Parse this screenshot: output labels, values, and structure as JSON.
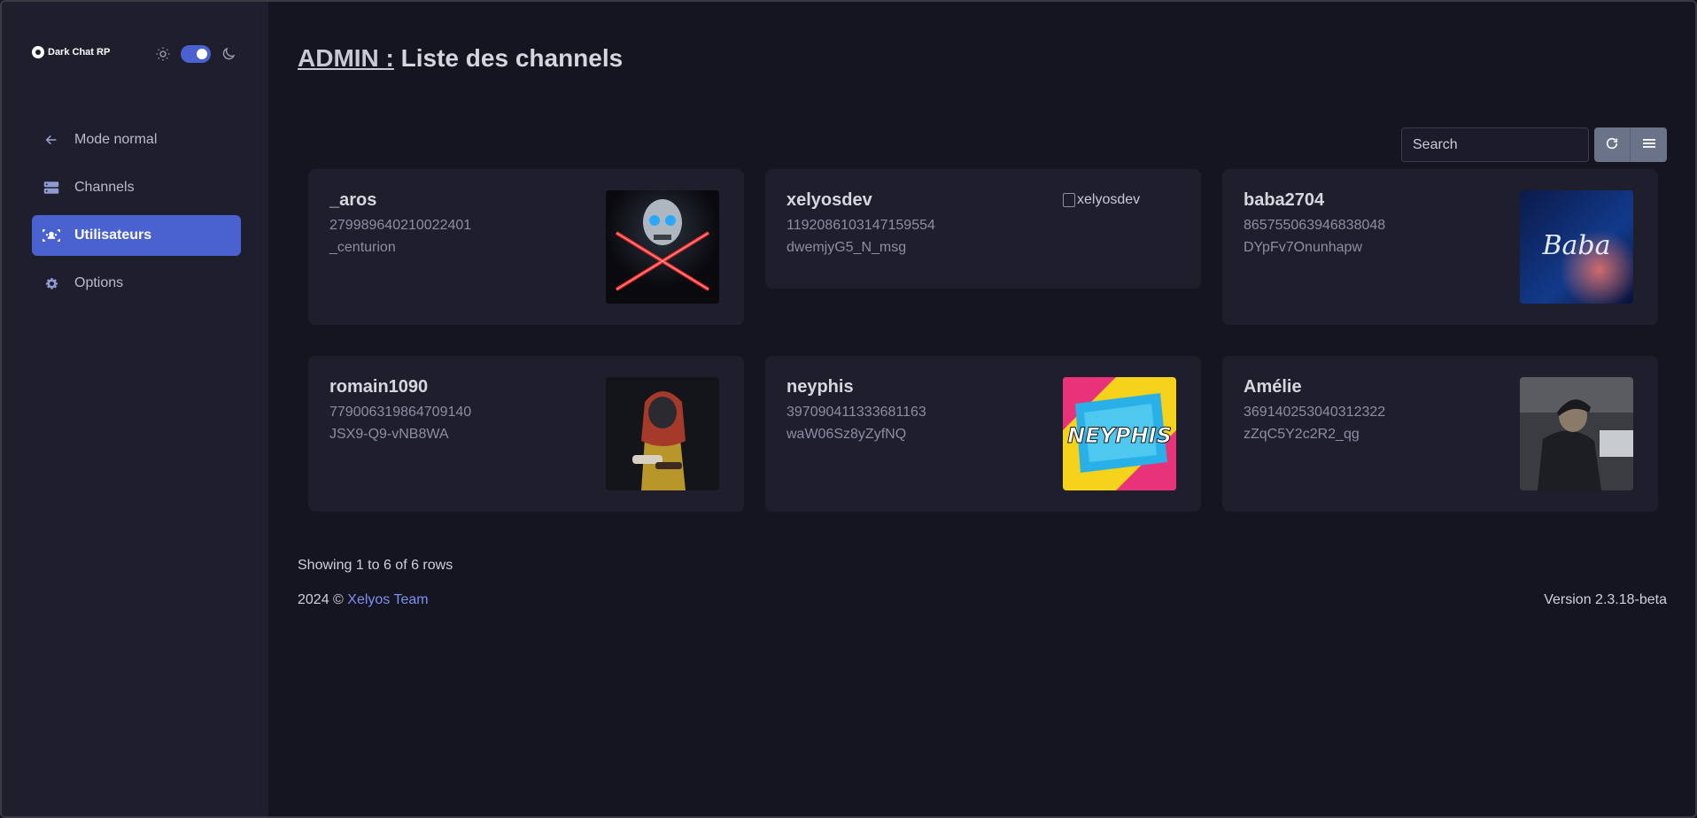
{
  "brand": {
    "name": "Dark Chat RP"
  },
  "theme": {
    "mode": "dark",
    "accent": "#4a62d0"
  },
  "sidebar": {
    "items": [
      {
        "label": "Mode normal",
        "icon": "arrow-left-icon",
        "active": false
      },
      {
        "label": "Channels",
        "icon": "server-icon",
        "active": false
      },
      {
        "label": "Utilisateurs",
        "icon": "users-icon",
        "active": true
      },
      {
        "label": "Options",
        "icon": "gear-icon",
        "active": false
      }
    ]
  },
  "header": {
    "admin": "ADMIN :",
    "title": "Liste des channels"
  },
  "search": {
    "placeholder": "Search"
  },
  "users": [
    {
      "name": "_aros",
      "id": "279989640210022401",
      "sub": "_centurion",
      "avatar": "skull-crossed-swords"
    },
    {
      "name": "xelyosdev",
      "id": "1192086103147159554",
      "sub": "dwemjyG5_N_msg",
      "avatar_alt": "xelyosdev"
    },
    {
      "name": "baba2704",
      "id": "865755063946838048",
      "sub": "DYpFv7Onunhapw",
      "avatar": "baba-script"
    },
    {
      "name": "romain1090",
      "id": "779006319864709140",
      "sub": "JSX9-Q9-vNB8WA",
      "avatar": "hazmat-figure"
    },
    {
      "name": "neyphis",
      "id": "397090411333681163",
      "sub": "waW06Sz8yZyfNQ",
      "avatar": "neyphis-logo",
      "avatar_text": "NEYPHIS"
    },
    {
      "name": "Amélie",
      "id": "369140253040312322",
      "sub": "zZqC5Y2c2R2_qg",
      "avatar": "operator-photo"
    }
  ],
  "avatars": {
    "baba_text": "Baba"
  },
  "footer": {
    "rows": "Showing 1 to 6 of 6 rows",
    "copy_prefix": "2024 © ",
    "team": "Xelyos Team",
    "version": "Version 2.3.18-beta"
  }
}
